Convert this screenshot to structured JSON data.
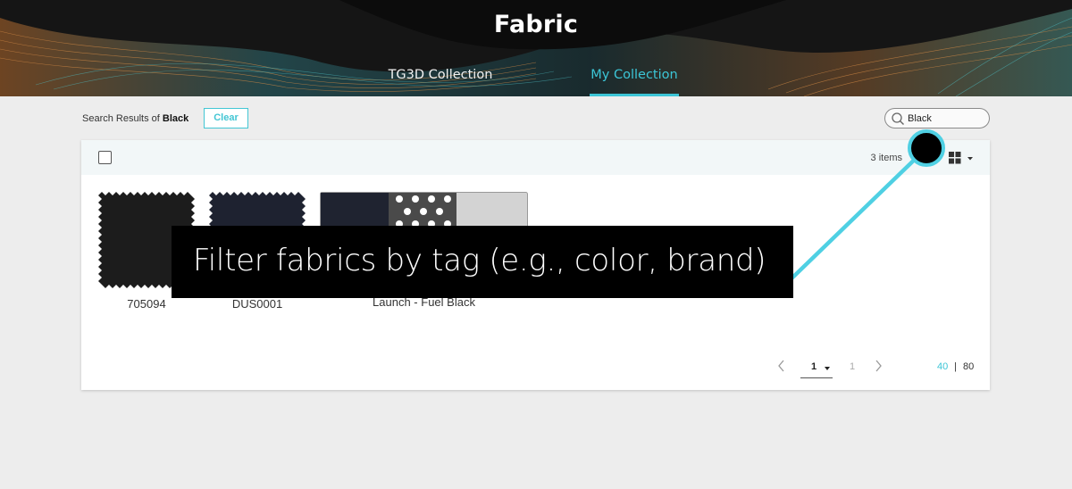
{
  "app": {
    "title": "Fabric",
    "tabs": [
      {
        "label": "TG3D Collection",
        "active": false
      },
      {
        "label": "My Collection",
        "active": true
      }
    ],
    "accent_color": "#3cc5d6"
  },
  "search": {
    "results_prefix": "Search Results of",
    "query_bold": "Black",
    "clear_label": "Clear",
    "input_value": "Black"
  },
  "toolbar": {
    "item_count": "3 items",
    "view_icon": "grid-view-icon"
  },
  "items": [
    {
      "caption": "705094",
      "swatch_color": "#1c1c1c"
    },
    {
      "caption": "DUS0001",
      "swatch_color": "#1e2230"
    },
    {
      "caption": "Launch - Fuel Black",
      "swatch_colors": [
        "#1f2330",
        "#4a4a4a",
        "#d3d3d3"
      ]
    }
  ],
  "pagination": {
    "current_page": "1",
    "total_pages": "1",
    "page_sizes": [
      "40",
      "80"
    ],
    "separator": "|",
    "active_size": "40"
  },
  "overlay": {
    "caption": "Filter fabrics by tag (e.g., color, brand)",
    "pointer_color": "#4fd0e3"
  }
}
